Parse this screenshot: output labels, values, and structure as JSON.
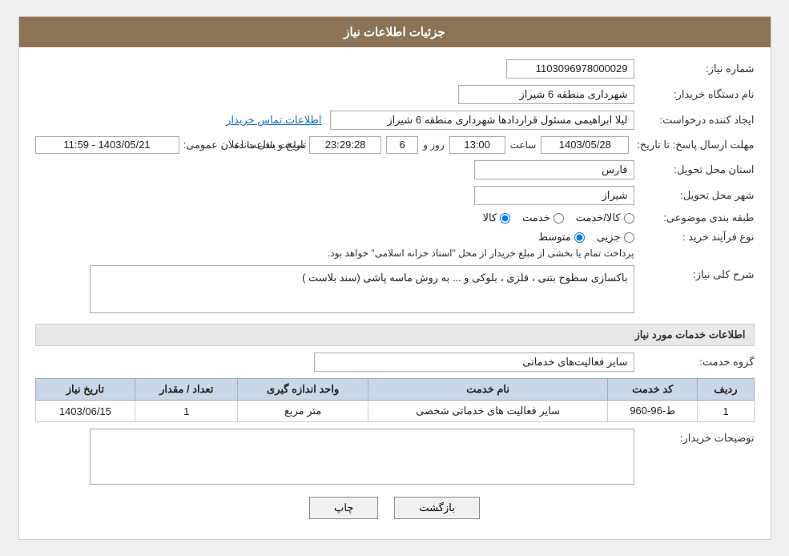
{
  "header": {
    "title": "جزئیات اطلاعات نیاز"
  },
  "fields": {
    "request_number_label": "شماره نیاز:",
    "request_number_value": "1103096978000029",
    "buyer_org_label": "نام دستگاه خریدار:",
    "buyer_org_value": "شهرداری منطقه 6 شیراز",
    "creator_label": "ایجاد کننده درخواست:",
    "creator_value": "لیلا ابراهیمی مسئول قراردادها شهرداری منطقه 6 شیراز",
    "contact_link": "اطلاعات تماس خریدار",
    "deadline_label": "مهلت ارسال پاسخ: تا تاریخ:",
    "deadline_date": "1403/05/28",
    "deadline_time_label": "ساعت",
    "deadline_time": "13:00",
    "deadline_day_label": "روز و",
    "deadline_days": "6",
    "deadline_remaining_label": "ساعت باقی مانده",
    "deadline_remaining": "23:29:28",
    "announce_label": "تاریخ و ساعت اعلان عمومی:",
    "announce_value": "1403/05/21 - 11:59",
    "province_label": "استان محل تحویل:",
    "province_value": "فارس",
    "city_label": "شهر محل تحویل:",
    "city_value": "شیراز",
    "category_label": "طبقه بندی موضوعی:",
    "category_service": "خدمت",
    "category_goods_service": "کالا/خدمت",
    "category_goods": "کالا",
    "process_label": "نوع فرآیند خرید :",
    "process_partial": "جزیی",
    "process_medium": "متوسط",
    "process_note": "پرداخت تمام یا بخشی از مبلغ خریدار از محل \"اسناد خزانه اسلامی\" خواهد بود.",
    "description_label": "شرح کلی نیاز:",
    "description_value": "باکسازی سطوح بتنی ، فلزی ، بلوکی و ... به روش ماسه پاشی (سند بلاست )",
    "services_section_title": "اطلاعات خدمات مورد نیاز",
    "service_group_label": "گروه خدمت:",
    "service_group_value": "سایر فعالیت‌های خدماتی",
    "table": {
      "columns": [
        "ردیف",
        "کد خدمت",
        "نام خدمت",
        "واحد اندازه گیری",
        "تعداد / مقدار",
        "تاریخ نیاز"
      ],
      "rows": [
        {
          "row": "1",
          "code": "ط-96-960",
          "name": "سایر فعالیت های خدماتی شخصی",
          "unit": "متر مربع",
          "quantity": "1",
          "date": "1403/06/15"
        }
      ]
    },
    "buyer_notes_label": "توضیحات خریدار:",
    "buyer_notes_value": ""
  },
  "buttons": {
    "back_label": "بازگشت",
    "print_label": "چاپ"
  }
}
